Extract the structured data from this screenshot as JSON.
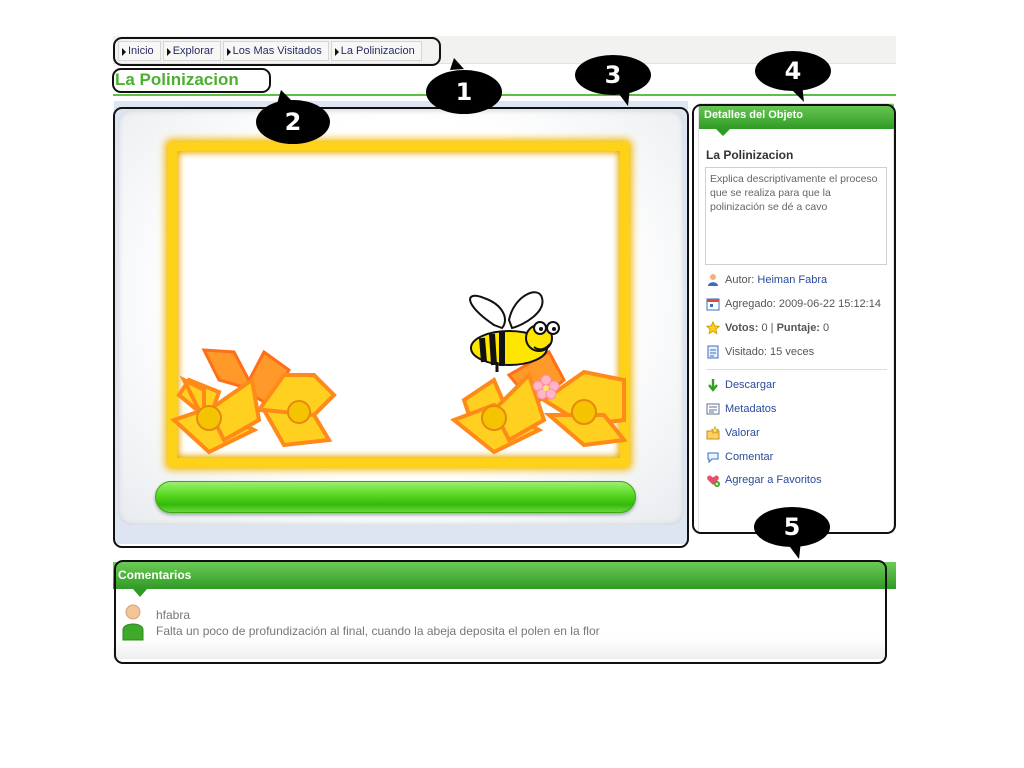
{
  "breadcrumb": {
    "items": [
      "Inicio",
      "Explorar",
      "Los Mas Visitados",
      "La Polinizacion"
    ]
  },
  "page": {
    "title": "La Polinizacion"
  },
  "details": {
    "header": "Detalles del Objeto",
    "object_title": "La Polinizacion",
    "description": "Explica descriptivamente el proceso que se realiza para que la polinización se dé a cavo",
    "author_label": "Autor:",
    "author_name": "Heiman Fabra",
    "added_label": "Agregado:",
    "added_value": "2009-06-22 15:12:14",
    "votes_label": "Votos:",
    "votes_value": "0",
    "sep": "|",
    "score_label": "Puntaje:",
    "score_value": "0",
    "visited": "Visitado: 15 veces",
    "actions": [
      "Descargar",
      "Metadatos",
      "Valorar",
      "Comentar",
      "Agregar a Favoritos"
    ]
  },
  "comments": {
    "header": "Comentarios",
    "items": [
      {
        "user": "hfabra",
        "text": "Falta un poco de profundización al final, cuando la abeja deposita el polen en la flor"
      }
    ]
  },
  "callouts": [
    "1",
    "2",
    "3",
    "4",
    "5"
  ],
  "colors": {
    "green_header": "#2f9a25",
    "title_green": "#4bb030",
    "link_blue": "#2a4a9a",
    "frame_yellow": "#ffd21a"
  }
}
